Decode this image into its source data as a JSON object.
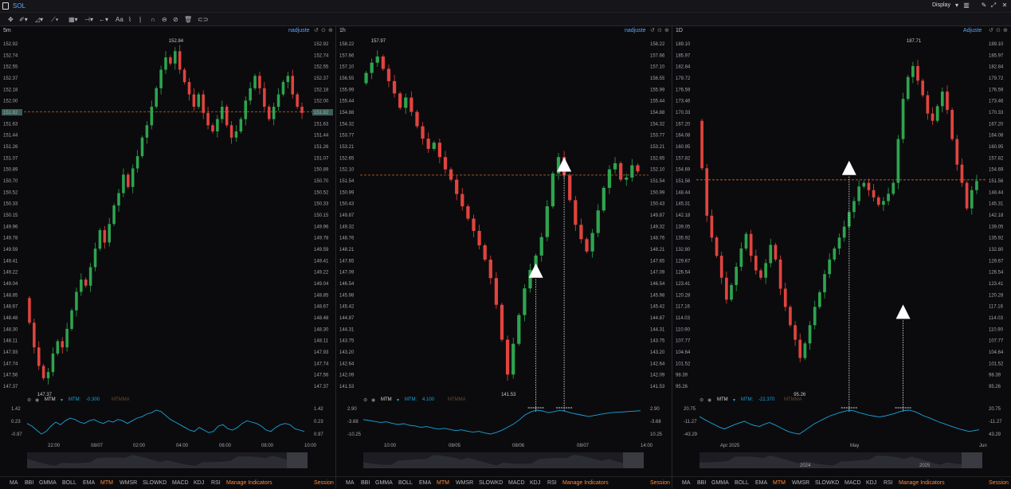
{
  "app": {
    "symbol": "SOL",
    "display_label": "Display"
  },
  "colors": {
    "up": "#2ea44f",
    "down": "#e0443e",
    "mtm": "#1aa3d9",
    "accent": "#ff8a3d",
    "link": "#5aa6ff",
    "price_tag_bg": "#3b5f58",
    "dashed": "#c76b2c"
  },
  "toolbar_icons": [
    "crosshair-icon",
    "pen-icon",
    "shapes-icon",
    "trendline-icon",
    "fib-icon",
    "measure-icon",
    "arrow-icon",
    "text-icon",
    "magnet-icon",
    "lock-icon",
    "hide-icon",
    "trash-icon",
    "settings-icon"
  ],
  "toolbar": {
    "text_tool": "Aa"
  },
  "current_price": "151.82",
  "indicator_tabs": [
    "MA",
    "BBI",
    "GMMA",
    "BOLL",
    "EMA",
    "MTM",
    "WMSR",
    "SLOWKD",
    "MACD",
    "KDJ",
    "RSI"
  ],
  "active_indicator": "MTM",
  "manage_label": "Manage Indicators",
  "session_label": "Session",
  "panels": [
    {
      "timeframe": "5m",
      "adjust_label": "nadjuste",
      "price_ticks": [
        "152.92",
        "152.74",
        "152.55",
        "152.37",
        "152.18",
        "152.00",
        "151.82",
        "151.63",
        "151.44",
        "151.26",
        "151.07",
        "150.89",
        "150.70",
        "150.52",
        "150.33",
        "150.15",
        "149.96",
        "149.78",
        "149.59",
        "149.41",
        "149.22",
        "149.04",
        "148.85",
        "148.67",
        "148.48",
        "148.30",
        "148.11",
        "147.93",
        "147.74",
        "147.56",
        "147.37"
      ],
      "high_label": "152.84",
      "low_label": "147.37",
      "mtm": {
        "name": "MTM",
        "value_label": "MTM:",
        "value": "-0.300",
        "mtmma": "MTMMA",
        "left_ticks": [
          "1.42",
          "0.23",
          "-0.97"
        ],
        "right_ticks": [
          "1.42",
          "0.23",
          "0.97"
        ]
      },
      "time_ticks": [
        "22:00",
        "08/07",
        "02:00",
        "04:00",
        "06:00",
        "08:00",
        "10:00"
      ],
      "arrows": [],
      "chart_data": {
        "type": "candlestick",
        "ylim": [
          147.37,
          152.92
        ],
        "closes": [
          148.4,
          148.0,
          147.7,
          147.5,
          147.6,
          147.9,
          148.1,
          148.0,
          148.3,
          148.6,
          148.9,
          149.1,
          149.0,
          149.3,
          149.6,
          149.9,
          149.7,
          150.0,
          150.3,
          150.5,
          150.8,
          150.6,
          150.9,
          151.1,
          151.4,
          151.6,
          151.9,
          152.2,
          152.5,
          152.7,
          152.6,
          152.8,
          152.5,
          152.3,
          152.1,
          151.9,
          152.1,
          151.8,
          151.6,
          151.5,
          151.7,
          151.9,
          151.6,
          151.4,
          151.5,
          151.7,
          152.0,
          152.2,
          152.4,
          152.2,
          151.9,
          151.7,
          151.9,
          152.1,
          152.3,
          152.4,
          152.1,
          151.9,
          151.8
        ],
        "mtm": [
          0.3,
          0.1,
          -0.2,
          -0.5,
          -0.3,
          0.1,
          0.4,
          0.2,
          0.5,
          0.7,
          0.6,
          0.4,
          0.3,
          0.5,
          0.6,
          0.4,
          0.3,
          0.5,
          0.4,
          0.6,
          0.5,
          0.3,
          0.5,
          0.7,
          0.8,
          1.0,
          1.1,
          1.3,
          1.2,
          0.9,
          0.6,
          0.4,
          0.2,
          0.0,
          -0.2,
          -0.3,
          0.0,
          -0.2,
          -0.4,
          -0.3,
          0.1,
          0.2,
          -0.1,
          -0.2,
          0.0,
          0.3,
          0.5,
          0.4,
          0.3,
          0.1,
          -0.2,
          -0.3,
          0.0,
          0.2,
          0.3,
          0.2,
          -0.1,
          -0.2,
          -0.3
        ]
      }
    },
    {
      "timeframe": "1h",
      "adjust_label": "nadjuste",
      "price_ticks": [
        "158.22",
        "157.66",
        "157.10",
        "156.55",
        "155.99",
        "155.44",
        "154.88",
        "154.32",
        "153.77",
        "153.21",
        "152.65",
        "152.10",
        "151.54",
        "150.99",
        "150.43",
        "149.87",
        "149.32",
        "148.76",
        "148.21",
        "147.65",
        "147.09",
        "146.54",
        "145.98",
        "145.42",
        "144.87",
        "144.31",
        "143.75",
        "143.20",
        "142.64",
        "142.09",
        "141.53"
      ],
      "high_label": "157.97",
      "low_label": "141.53",
      "mtm": {
        "name": "MTM",
        "value_label": "MTM:",
        "value": "4.100",
        "mtmma": "MTMMA",
        "left_ticks": [
          "2.90",
          "-3.68",
          "-10.25"
        ],
        "right_ticks": [
          "2.90",
          "-3.68",
          "10.25"
        ]
      },
      "time_ticks": [
        "10:00",
        "08/05",
        "08/06",
        "08/07",
        "14:00"
      ],
      "arrows": [
        {
          "candle": 30,
          "target": 0.66
        },
        {
          "candle": 35,
          "target": 0.35
        }
      ],
      "chart_data": {
        "type": "candlestick",
        "ylim": [
          141.53,
          158.22
        ],
        "closes": [
          156.8,
          157.3,
          157.6,
          157.0,
          156.4,
          155.8,
          155.1,
          155.6,
          154.9,
          154.2,
          153.6,
          153.1,
          153.4,
          152.7,
          152.1,
          151.6,
          150.9,
          150.3,
          149.7,
          149.1,
          148.4,
          147.7,
          146.8,
          145.5,
          143.8,
          142.1,
          143.6,
          145.0,
          146.3,
          147.2,
          147.9,
          148.8,
          150.3,
          151.9,
          152.7,
          151.8,
          150.6,
          149.4,
          148.7,
          148.1,
          149.0,
          150.1,
          151.2,
          152.1,
          152.4,
          151.6,
          151.7,
          152.3,
          152.0
        ],
        "mtm": [
          -2.0,
          -2.5,
          -3.0,
          -3.5,
          -3.2,
          -4.0,
          -4.6,
          -4.2,
          -5.0,
          -5.4,
          -6.1,
          -5.7,
          -6.4,
          -7.0,
          -6.6,
          -7.2,
          -7.8,
          -7.4,
          -8.1,
          -8.6,
          -8.2,
          -9.0,
          -9.6,
          -8.8,
          -7.6,
          -6.0,
          -4.4,
          -2.2,
          0.4,
          2.0,
          2.9,
          2.5,
          1.6,
          2.1,
          2.8,
          2.3,
          1.4,
          0.8,
          0.2,
          -0.4,
          0.1,
          0.7,
          1.2,
          1.6,
          1.8,
          2.0,
          2.2,
          2.4,
          2.6
        ]
      }
    },
    {
      "timeframe": "1D",
      "adjust_label": "Adjuste",
      "price_ticks": [
        "189.10",
        "185.97",
        "182.84",
        "179.72",
        "176.59",
        "173.46",
        "170.33",
        "167.20",
        "164.08",
        "160.95",
        "157.82",
        "154.69",
        "151.56",
        "148.44",
        "145.31",
        "142.18",
        "139.05",
        "135.92",
        "132.80",
        "129.67",
        "126.54",
        "123.41",
        "120.28",
        "117.16",
        "114.03",
        "110.90",
        "107.77",
        "104.64",
        "101.52",
        "98.39",
        "95.26"
      ],
      "high_label": "187.71",
      "low_label": "95.26",
      "mtm": {
        "name": "MTM",
        "value_label": "MTM:",
        "value": "-22.370",
        "mtmma": "MTMMA",
        "left_ticks": [
          "20.75",
          "-11.27",
          "-43.29"
        ],
        "right_ticks": [
          "20.75",
          "-11.27",
          "43.29"
        ]
      },
      "time_ticks": [
        "Apr 2025",
        "May",
        "Jun"
      ],
      "year_ticks": [
        "2024",
        "2025"
      ],
      "arrows": [
        {
          "candle": 30,
          "target": 0.36
        },
        {
          "candle": 41,
          "target": 0.78
        }
      ],
      "chart_data": {
        "type": "candlestick",
        "ylim": [
          95.26,
          189.1
        ],
        "closes": [
          155.0,
          142.0,
          136.0,
          131.0,
          125.0,
          119.0,
          123.0,
          128.0,
          133.0,
          137.0,
          131.0,
          127.0,
          125.0,
          129.0,
          134.0,
          130.0,
          122.0,
          117.0,
          112.0,
          108.0,
          103.0,
          107.0,
          112.0,
          117.0,
          121.0,
          126.0,
          130.0,
          133.0,
          136.0,
          139.0,
          143.0,
          146.0,
          150.0,
          151.0,
          149.0,
          147.0,
          145.0,
          146.0,
          148.0,
          151.0,
          163.0,
          174.0,
          180.0,
          183.0,
          179.0,
          175.0,
          170.0,
          168.0,
          172.0,
          176.0,
          171.0,
          163.0,
          156.0,
          151.0,
          144.0,
          149.0,
          151.5
        ]
      },
      "mtm_series": [
        5,
        -2,
        -8,
        -14,
        -20,
        -24,
        -19,
        -14,
        -10,
        -6,
        -12,
        -16,
        -18,
        -13,
        -9,
        -14,
        -20,
        -26,
        -31,
        -34,
        -36,
        -28,
        -20,
        -12,
        -6,
        0,
        6,
        10,
        14,
        17,
        20,
        18,
        14,
        11,
        8,
        6,
        4,
        6,
        9,
        12,
        16,
        19,
        20,
        17,
        12,
        6,
        2,
        -3,
        -8,
        -12,
        -16,
        -20,
        -24,
        -27,
        -30,
        -28,
        -26
      ]
    }
  ]
}
